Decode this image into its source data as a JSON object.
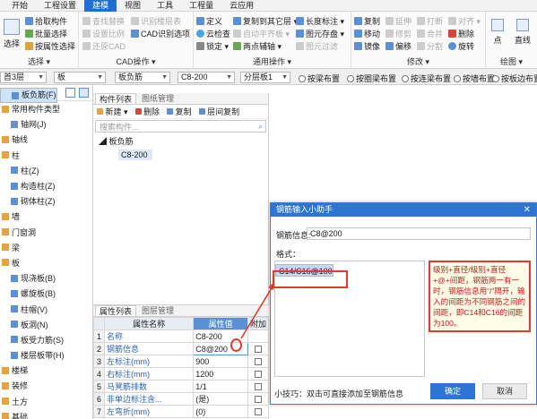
{
  "menubar": {
    "items": [
      "开始",
      "工程设置",
      "建模",
      "视图",
      "工具",
      "工程量",
      "云应用"
    ],
    "active_index": 2
  },
  "ribbon": {
    "select_group": {
      "big_label": "选择",
      "items": [
        "拾取构件",
        "批量选择",
        "按属性选择"
      ],
      "title": "选择 ▾"
    },
    "cad_group": {
      "items_col1": [
        "查找替换",
        "设置比例",
        "还原CAD"
      ],
      "items_col2": [
        "识别楼层表",
        "CAD识别选项"
      ],
      "title": "CAD操作 ▾"
    },
    "common_group": {
      "col1": [
        "定义",
        "云检查",
        "锁定 ▾"
      ],
      "col2": [
        "复制到其它层 ▾",
        "自动平齐板 ▾",
        "两点辅轴 ▾"
      ],
      "col3": [
        "长度标注 ▾",
        "图元存盘 ▾",
        "图元过滤"
      ],
      "title": "通用操作 ▾"
    },
    "modify_group": {
      "col1": [
        "复制",
        "移动",
        "镜像"
      ],
      "col2": [
        "延伸",
        "修剪",
        "偏移"
      ],
      "col3": [
        "打断",
        "合并",
        "分割"
      ],
      "col4": [
        "对齐 ▾",
        "删除",
        "旋转"
      ],
      "title": "修改 ▾"
    },
    "draw_group": {
      "items": [
        "点",
        "直线"
      ],
      "title": "绘图 ▾"
    }
  },
  "selbar": {
    "floor": "首3层",
    "category": "板",
    "component": "板负筋",
    "spec": "C8-200",
    "layer": "分层板1",
    "radios": [
      "按梁布置",
      "按圈梁布置",
      "按连梁布置",
      "按墙布置",
      "按板边布置"
    ]
  },
  "lefttree": {
    "items": [
      {
        "label": "常用构件类型",
        "level": 0,
        "icon": "folder-icon",
        "color": "#e8a33c"
      },
      {
        "label": "轴网(J)",
        "level": 1,
        "icon": "grid-icon",
        "color": "#6a8fc8"
      },
      {
        "label": "轴线",
        "level": 0,
        "icon": "folder-icon",
        "color": "#e8a33c"
      },
      {
        "label": "柱",
        "level": 0,
        "icon": "folder-icon",
        "color": "#e8a33c"
      },
      {
        "label": "柱(Z)",
        "level": 1,
        "icon": "column-icon",
        "color": "#5b8fd6"
      },
      {
        "label": "构造柱(Z)",
        "level": 1,
        "icon": "column-icon",
        "color": "#5b8fd6"
      },
      {
        "label": "砌体柱(Z)",
        "level": 1,
        "icon": "column-icon",
        "color": "#5b8fd6"
      },
      {
        "label": "墙",
        "level": 0,
        "icon": "folder-icon",
        "color": "#e8a33c"
      },
      {
        "label": "门窗洞",
        "level": 0,
        "icon": "folder-icon",
        "color": "#e8a33c"
      },
      {
        "label": "梁",
        "level": 0,
        "icon": "folder-icon",
        "color": "#e8a33c"
      },
      {
        "label": "板",
        "level": 0,
        "icon": "folder-icon",
        "color": "#e8a33c"
      },
      {
        "label": "现浇板(B)",
        "level": 1,
        "icon": "slab-icon",
        "color": "#5b8fd6"
      },
      {
        "label": "螺旋板(B)",
        "level": 1,
        "icon": "slab-icon",
        "color": "#5b8fd6"
      },
      {
        "label": "柱帽(V)",
        "level": 1,
        "icon": "column-icon",
        "color": "#5b8fd6"
      },
      {
        "label": "板洞(N)",
        "level": 1,
        "icon": "slab-icon",
        "color": "#5b8fd6"
      },
      {
        "label": "板受力筋(S)",
        "level": 1,
        "icon": "rebar-icon",
        "color": "#5b8fd6"
      },
      {
        "label": "板负筋(F)",
        "level": 1,
        "icon": "rebar-icon",
        "color": "#5b8fd6",
        "selected": true
      },
      {
        "label": "楼层板带(H)",
        "level": 1,
        "icon": "slab-icon",
        "color": "#5b8fd6"
      },
      {
        "label": "楼梯",
        "level": 0,
        "icon": "folder-icon",
        "color": "#e8a33c"
      },
      {
        "label": "装修",
        "level": 0,
        "icon": "folder-icon",
        "color": "#e8a33c"
      },
      {
        "label": "土方",
        "level": 0,
        "icon": "folder-icon",
        "color": "#e8a33c"
      },
      {
        "label": "基础",
        "level": 0,
        "icon": "folder-icon",
        "color": "#e8a33c"
      },
      {
        "label": "其它",
        "level": 0,
        "icon": "folder-icon",
        "color": "#e8a33c"
      }
    ]
  },
  "comppanel": {
    "tabs": [
      "构件列表",
      "图纸管理"
    ],
    "toolbar": [
      "新建 ▾",
      "删除",
      "复制",
      "层间复制"
    ],
    "search_placeholder": "搜索构件...",
    "tree_root": "板负筋",
    "tree_child": "C8-200"
  },
  "proppanel": {
    "tabs": [
      "属性列表",
      "图层管理"
    ],
    "headers": [
      "属性名称",
      "属性值",
      "附加"
    ],
    "rows": [
      {
        "n": "1",
        "name": "名称",
        "value": "C8-200",
        "chk": false
      },
      {
        "n": "2",
        "name": "钢筋信息",
        "value": "C8@200",
        "chk": true
      },
      {
        "n": "3",
        "name": "左标注(mm)",
        "value": "900",
        "chk": true
      },
      {
        "n": "4",
        "name": "右标注(mm)",
        "value": "1200",
        "chk": true
      },
      {
        "n": "5",
        "name": "马凳筋排数",
        "value": "1/1",
        "chk": true
      },
      {
        "n": "6",
        "name": "非单边标注含...",
        "value": "(是)",
        "chk": true
      },
      {
        "n": "7",
        "name": "左弯折(mm)",
        "value": "(0)",
        "chk": true
      }
    ]
  },
  "dialog": {
    "title": "钢筋输入小助手",
    "close": "✕",
    "info_label": "钢筋信息:",
    "info_value": "C8@200",
    "format_label": "格式：",
    "formats": [
      "C16@100",
      "C14/C16@100"
    ],
    "selected_format": 1,
    "hint": "级别+直径/级别+直径+@+间距，钢筋两一有一时，钢筋信息用“/”隔开，输入的间距为不同钢筋之间的间距，即C14和C16的间距为100。",
    "tip": "小技巧：双击可直接添加至钢筋信息",
    "ok": "确定",
    "cancel": "取消"
  },
  "colors": {
    "accent": "#2d74d3",
    "annotation": "#e23a2f",
    "hint_bg": "#fffde6"
  }
}
